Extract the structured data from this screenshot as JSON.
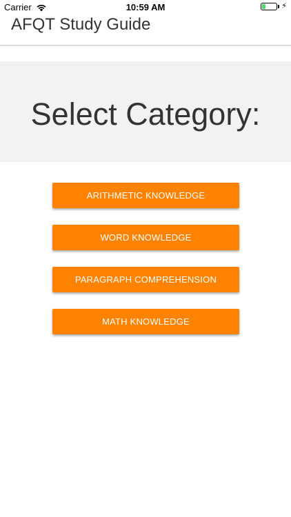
{
  "status_bar": {
    "carrier": "Carrier",
    "time": "10:59 AM",
    "wifi_icon": "wifi-icon",
    "battery_icon": "battery-icon",
    "charging_icon": "bolt-icon",
    "battery_level": 0.25,
    "battery_color": "#4cd964"
  },
  "nav": {
    "title": "AFQT Study Guide"
  },
  "banner": {
    "title": "Select Category:",
    "background": "#f2f2f2"
  },
  "categories": {
    "accent_color": "#ff8300",
    "items": [
      {
        "label": "ARITHMETIC KNOWLEDGE"
      },
      {
        "label": "WORD KNOWLEDGE"
      },
      {
        "label": "PARAGRAPH COMPREHENSION"
      },
      {
        "label": "MATH KNOWLEDGE"
      }
    ]
  }
}
